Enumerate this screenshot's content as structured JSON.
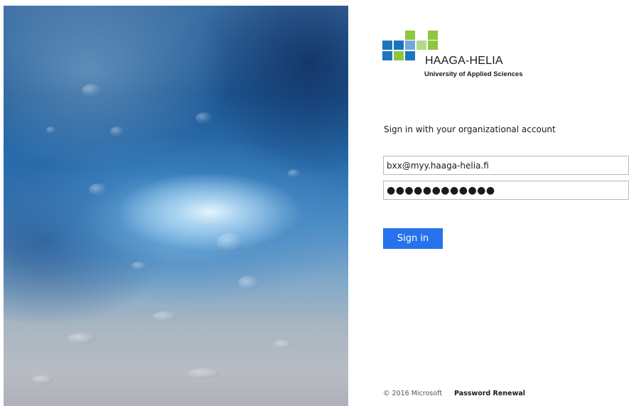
{
  "branding": {
    "logo_name": "HAAGA-HELIA",
    "logo_subtitle": "University of Applied Sciences",
    "colors": {
      "logo_blue": "#1c75bc",
      "logo_blue_light": "#6fa8dc",
      "logo_green": "#8dc63f",
      "logo_green_light": "#b5d98a"
    }
  },
  "illustration": {
    "description_icon": "rain-sky-image"
  },
  "signin": {
    "heading": "Sign in with your organizational account",
    "email_value": "bxx@myy.haaga-helia.fi",
    "password_value": "●●●●●●●●●●●●",
    "button_label": "Sign in",
    "button_color": "#2672ec"
  },
  "footer": {
    "copyright": "© 2016 Microsoft",
    "password_renewal": "Password Renewal"
  }
}
